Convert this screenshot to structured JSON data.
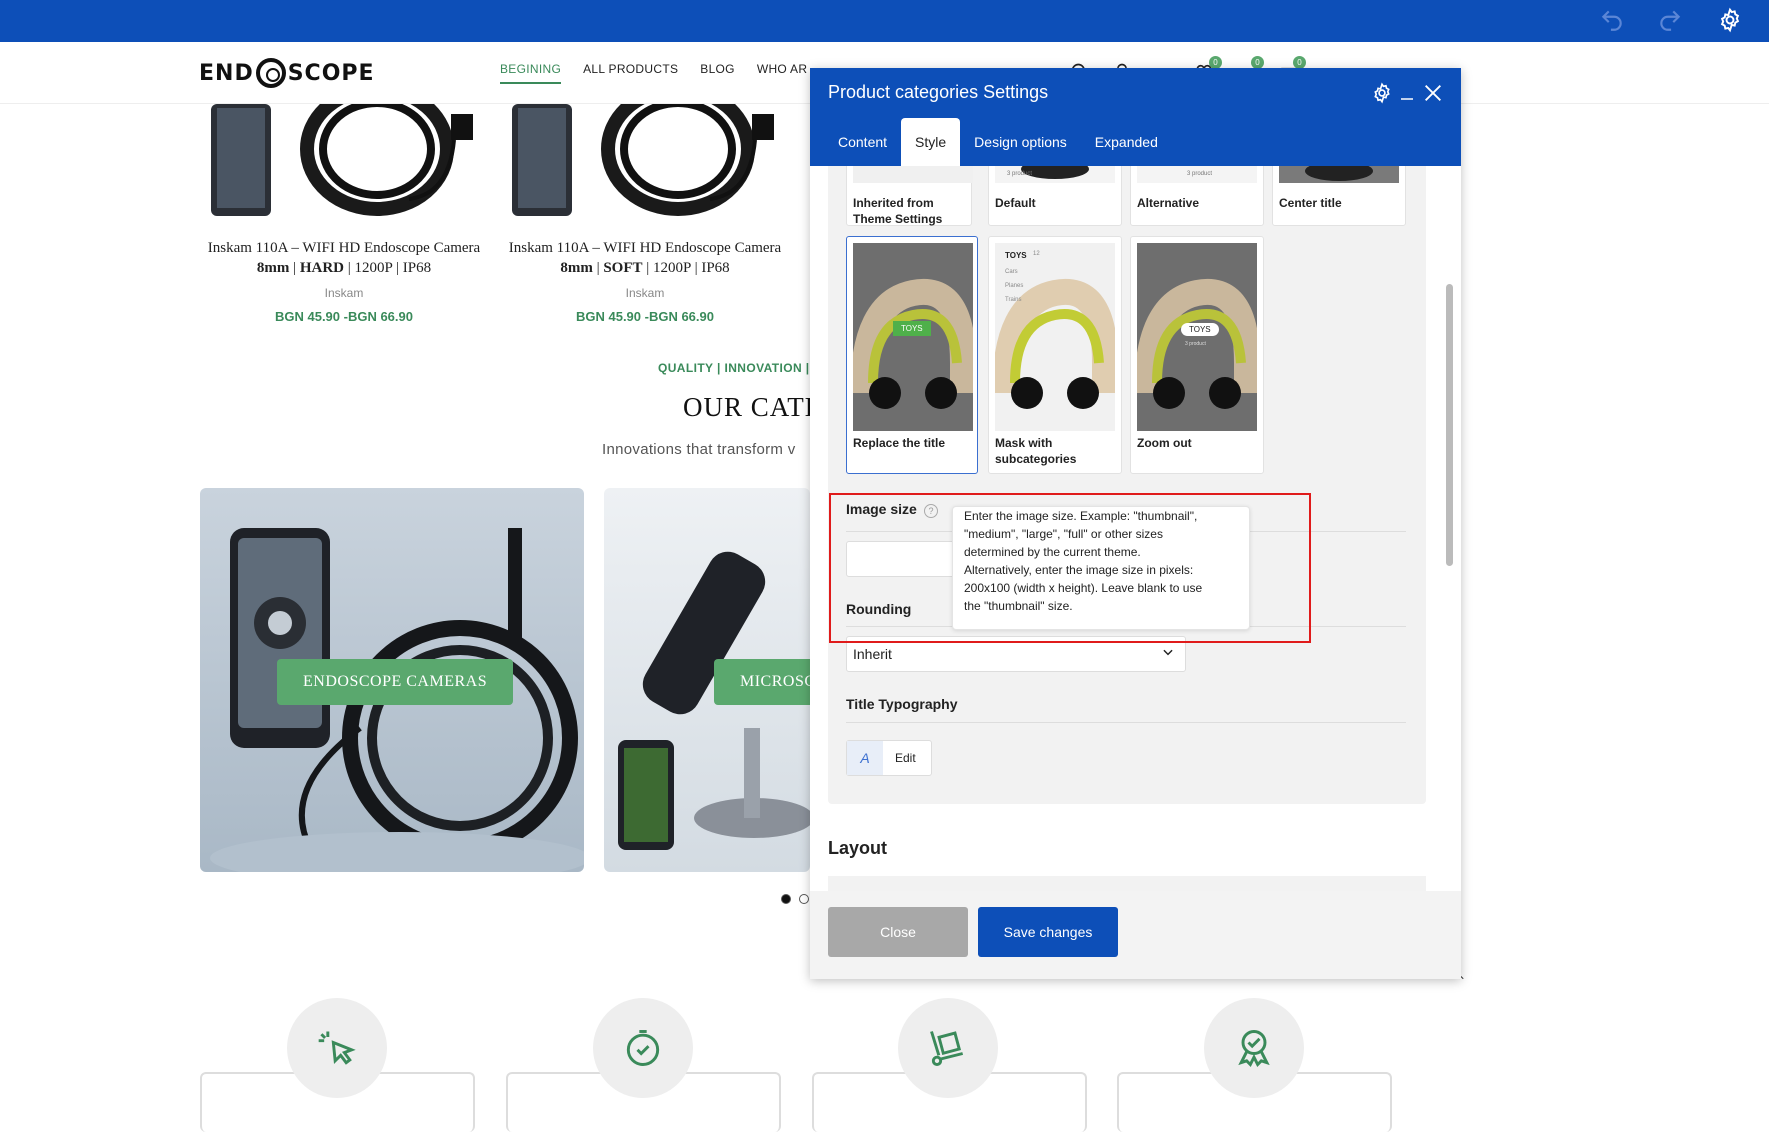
{
  "header": {
    "logo": {
      "part1": "END",
      "part2": "SCOPE"
    },
    "nav": [
      "BEGINING",
      "ALL PRODUCTS",
      "BLOG",
      "WHO AR"
    ],
    "badges": [
      "0",
      "0",
      "0"
    ]
  },
  "products": [
    {
      "name1": "Inskam 110A – WIFI HD Endoscope Camera",
      "name2_bold1": "8mm",
      "name2_sep1": " | ",
      "name2_bold2": "HARD",
      "name2_rest": " | 1200P | IP68",
      "brand": "Inskam",
      "price": "BGN 45.90 -BGN 66.90"
    },
    {
      "name1": "Inskam 110A – WIFI HD Endoscope Camera",
      "name2_bold1": "8mm",
      "name2_sep1": " | ",
      "name2_bold2": "SOFT",
      "name2_rest": " | 1200P | IP68",
      "brand": "Inskam",
      "price": "BGN 45.90 -BGN 66.90"
    }
  ],
  "categories_section": {
    "tagline": "QUALITY | INNOVATION |",
    "heading": "OUR CATE",
    "subheading": "Innovations that transform v",
    "cards": [
      "ENDOSCOPE CAMERAS",
      "MICROSC"
    ]
  },
  "modal": {
    "title": "Product categories Settings",
    "tabs": [
      "Content",
      "Style",
      "Design options",
      "Expanded"
    ],
    "top_options": [
      {
        "label": "Inherited from\nTheme Settings",
        "mini": ""
      },
      {
        "label": "Default",
        "mini": "3 product"
      },
      {
        "label": "Alternative",
        "mini": "3 product"
      },
      {
        "label": "Center title",
        "mini": ""
      }
    ],
    "image_options": [
      {
        "label": "Replace the title",
        "tag": "TOYS"
      },
      {
        "label": "Mask with\nsubcategories",
        "tag": "TOYS",
        "sublist": [
          "Cars",
          "Planes",
          "Trains"
        ],
        "count": "12"
      },
      {
        "label": "Zoom out",
        "tag": "TOYS",
        "sub": "3 product"
      }
    ],
    "image_size_label": "Image size",
    "help_symbol": "?",
    "tooltip": "Enter the image size. Example: \"thumbnail\",\n\"medium\", \"large\", \"full\" or other sizes\ndetermined by the current theme.\nAlternatively, enter the image size in pixels:\n200x100 (width x height). Leave blank to use\nthe \"thumbnail\" size.",
    "rounding_label": "Rounding",
    "rounding_value": "Inherit",
    "title_typography_label": "Title Typography",
    "edit_label": "Edit",
    "layout_title": "Layout",
    "close_label": "Close",
    "save_label": "Save changes"
  },
  "colors": {
    "brand_blue": "#0d4fb8",
    "accent_green": "#5aa86e",
    "highlight_red": "#e01b1b"
  }
}
